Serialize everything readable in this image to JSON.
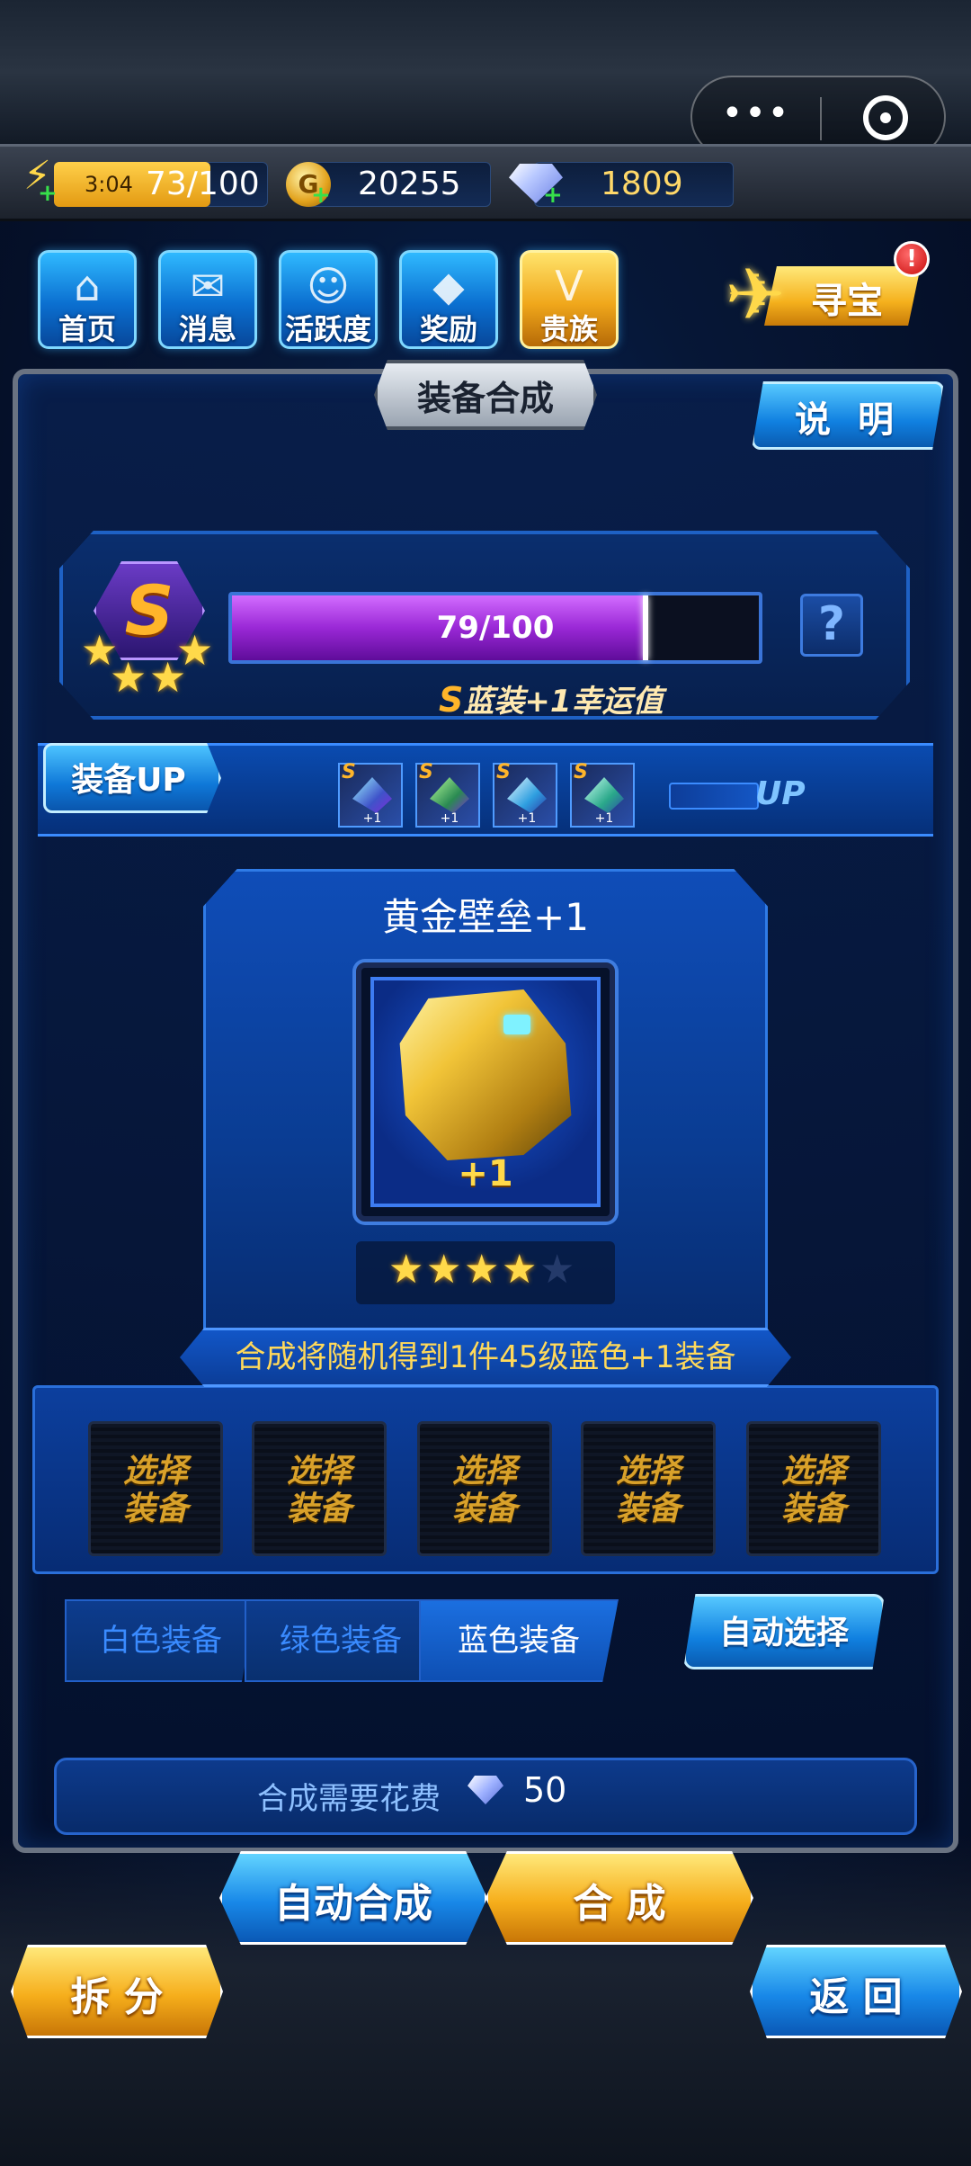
{
  "capsule": {
    "more": "•••"
  },
  "resources": {
    "energy_timer": "3:04",
    "energy": "73/100",
    "coins": "20255",
    "gems": "1809",
    "energy_progress": 0.73
  },
  "nav": {
    "items": [
      {
        "label": "首页",
        "icon": "home-icon"
      },
      {
        "label": "消息",
        "icon": "message-icon"
      },
      {
        "label": "活跃度",
        "icon": "activity-icon"
      },
      {
        "label": "奖励",
        "icon": "gift-icon"
      },
      {
        "label": "贵族",
        "icon": "vip-icon"
      }
    ],
    "treasure": "寻宝",
    "alert": "!"
  },
  "panel": {
    "title": "装备合成",
    "explain": "说 明"
  },
  "luck": {
    "grade": "S",
    "stars": 3,
    "progress_text": "79/100",
    "progress": 0.79,
    "desc_s": "S",
    "desc": "蓝装+1幸运值",
    "help": "?"
  },
  "equip_up": {
    "label": "装备UP",
    "grade": "S",
    "plus": "+1",
    "up": "UP"
  },
  "result": {
    "name": "黄金壁垒+1",
    "plus": "+1",
    "stars": 4,
    "max_stars": 5
  },
  "synth": {
    "banner": "合成将随机得到1件45级蓝色+1装备",
    "slot_label_line1": "选择",
    "slot_label_line2": "装备"
  },
  "tabs": {
    "white": "白色装备",
    "green": "绿色装备",
    "blue": "蓝色装备",
    "auto_select": "自动选择"
  },
  "cost": {
    "label": "合成需要花费",
    "value": "50"
  },
  "buttons": {
    "auto_synth": "自动合成",
    "synth": "合 成",
    "split": "拆 分",
    "back": "返 回"
  },
  "colors": {
    "accent_blue": "#1080e0",
    "accent_gold": "#f6ae1b",
    "luck_purple": "#9a28d6"
  }
}
